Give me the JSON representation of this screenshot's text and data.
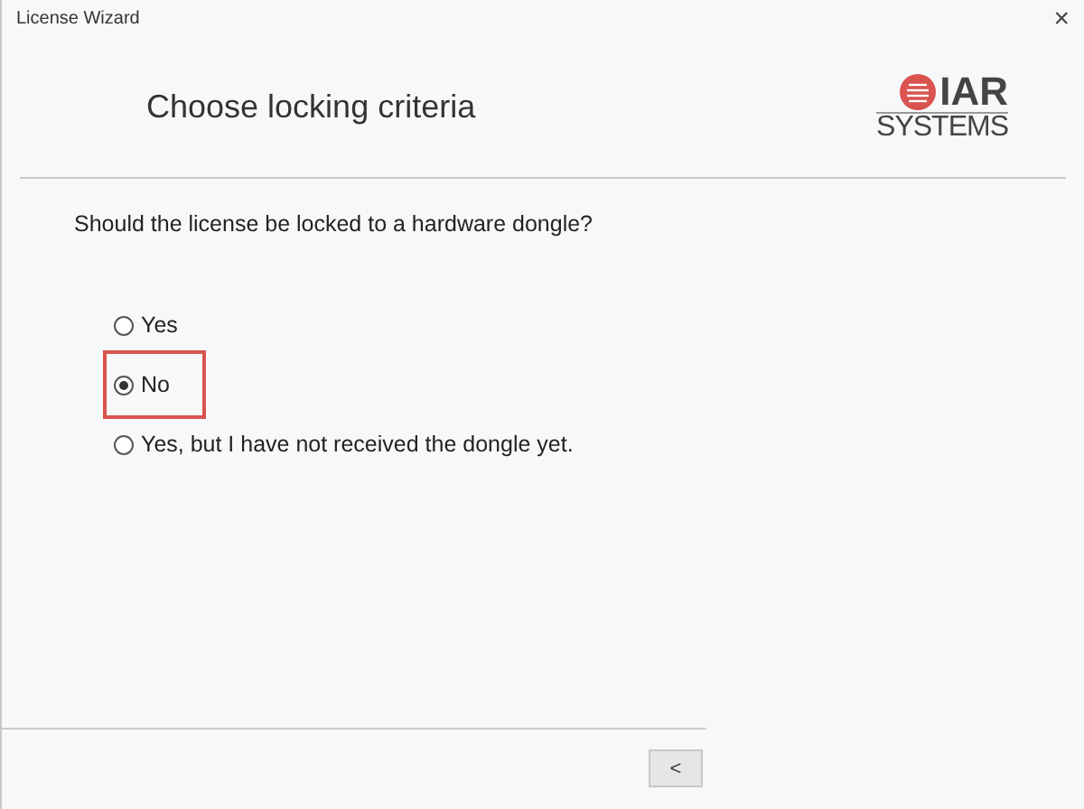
{
  "window": {
    "title": "License Wizard",
    "close": "×"
  },
  "header": {
    "title": "Choose locking criteria",
    "logo": {
      "top": "IAR",
      "bottom": "SYSTEMS"
    }
  },
  "question": "Should the license be locked to a hardware dongle?",
  "options": [
    {
      "label": "Yes",
      "selected": false,
      "highlighted": false
    },
    {
      "label": "No",
      "selected": true,
      "highlighted": true
    },
    {
      "label": "Yes, but I have not received the dongle yet.",
      "selected": false,
      "highlighted": false
    }
  ],
  "buttons": [
    "<"
  ]
}
